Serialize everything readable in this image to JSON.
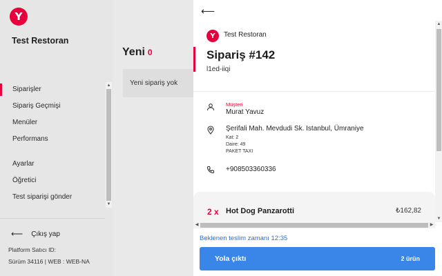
{
  "sidebar": {
    "logo_letter": "Y",
    "store_name": "Test Restoran",
    "nav_primary": [
      {
        "label": "Siparişler",
        "active": true
      },
      {
        "label": "Sipariş Geçmişi",
        "active": false
      },
      {
        "label": "Menüler",
        "active": false
      },
      {
        "label": "Performans",
        "active": false
      }
    ],
    "nav_secondary": [
      {
        "label": "Ayarlar"
      },
      {
        "label": "Öğretici"
      },
      {
        "label": "Test siparişi gönder"
      }
    ],
    "logout_label": "Çıkış yap",
    "platform_label": "Platform Satıcı ID:",
    "version_label": "Sürüm 34116 | WEB : WEB-NA"
  },
  "middle": {
    "title": "Yeni",
    "count": "0",
    "empty_text": "Yeni sipariş yok"
  },
  "order": {
    "logo_letter": "Y",
    "store_name": "Test Restoran",
    "title": "Sipariş #142",
    "code": "l1ed-iiqi",
    "customer_label": "Müşteri",
    "customer_name": "Murat Yavuz",
    "address": "Şerifali Mah. Mevdudi Sk. Istanbul, Ümraniye",
    "floor": "Kat: 2",
    "door": "Daire: 49",
    "delivery_note": "PAKET TAXI",
    "phone": "+908503360336",
    "item": {
      "qty": "2 x",
      "name": "Hot Dog Panzarotti",
      "price": "₺162,82"
    },
    "eta_label": "Beklenen teslim zamanı 12:35",
    "dispatch_label": "Yola çıktı",
    "dispatch_count": "2 ürün"
  },
  "colors": {
    "brand": "#e8003d",
    "action_blue": "#3a86e8",
    "link_blue": "#2b6ed6"
  },
  "icons": {
    "back": "arrow-left-icon",
    "customer": "person-icon",
    "address": "location-pin-icon",
    "phone": "phone-icon",
    "logout": "arrow-left-icon"
  }
}
